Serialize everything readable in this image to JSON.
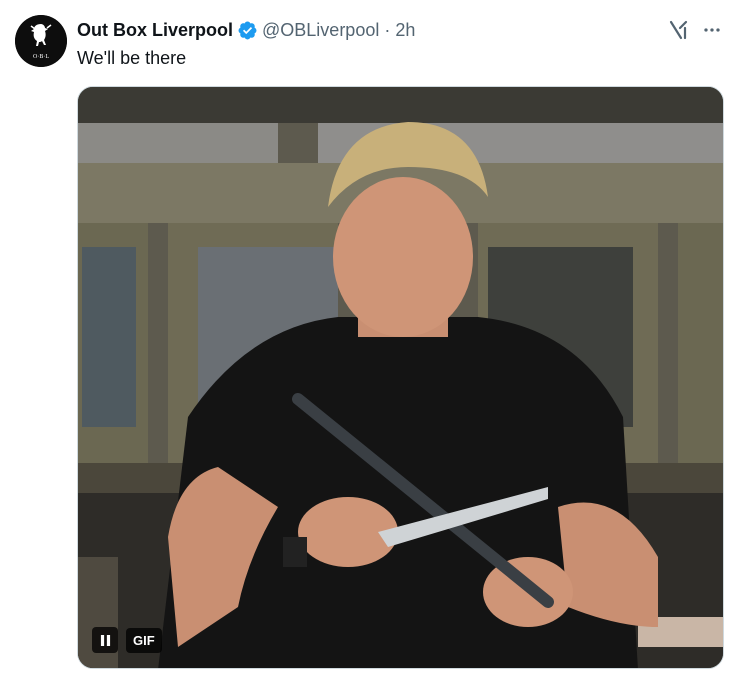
{
  "tweet": {
    "author": {
      "display_name": "Out Box Liverpool",
      "handle": "@OBLiverpool",
      "verified": true,
      "avatar_icon": "liverbird-logo-icon",
      "avatar_text": "O·B·L"
    },
    "separator": "·",
    "time": "2h",
    "text": "We'll be there",
    "media": {
      "type": "gif",
      "badge_label": "GIF",
      "state": "playing",
      "control_icon": "pause-icon",
      "description_icon": "chef-sharpening-knife-gif"
    },
    "actions": {
      "grok_icon": "grok-icon",
      "more_icon": "more-options-icon"
    }
  },
  "colors": {
    "text_primary": "#0f1419",
    "text_secondary": "#536471",
    "verified_blue": "#1d9bf0",
    "background": "#ffffff"
  }
}
